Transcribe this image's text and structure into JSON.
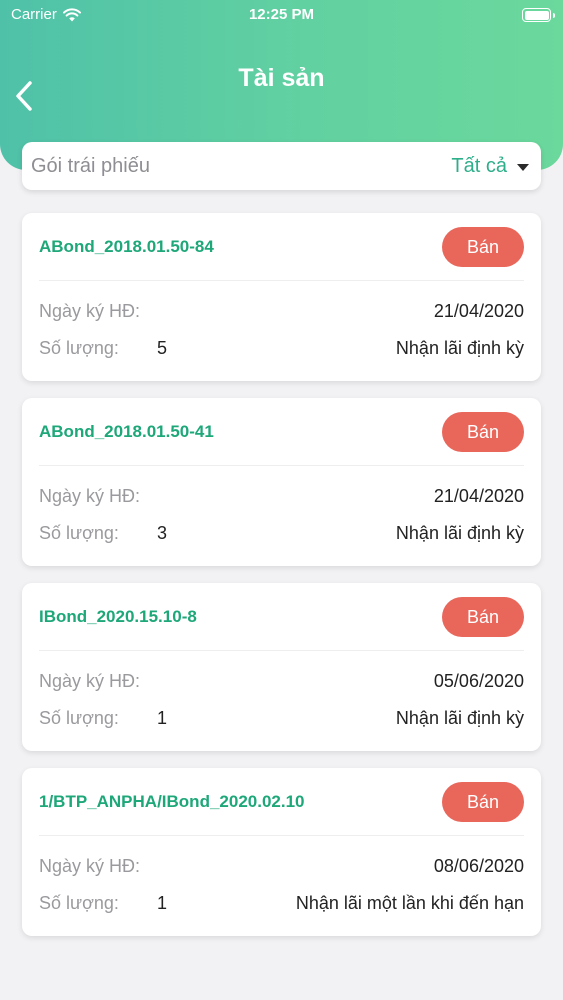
{
  "status_bar": {
    "carrier": "Carrier",
    "time": "12:25 PM"
  },
  "header": {
    "title": "Tài sản",
    "back_icon": "chevron-left-icon"
  },
  "filter": {
    "label": "Gói trái phiếu",
    "value": "Tất cả"
  },
  "labels": {
    "contract_date": "Ngày ký HĐ:",
    "quantity": "Số lượng:",
    "sell": "Bán"
  },
  "assets": [
    {
      "name": "ABond_2018.01.50-84",
      "date": "21/04/2020",
      "quantity": "5",
      "interest": "Nhận lãi định kỳ"
    },
    {
      "name": "ABond_2018.01.50-41",
      "date": "21/04/2020",
      "quantity": "3",
      "interest": "Nhận lãi định kỳ"
    },
    {
      "name": "IBond_2020.15.10-8",
      "date": "05/06/2020",
      "quantity": "1",
      "interest": "Nhận lãi định kỳ"
    },
    {
      "name": "1/BTP_ANPHA/IBond_2020.02.10",
      "date": "08/06/2020",
      "quantity": "1",
      "interest": "Nhận lãi một lần khi đến hạn"
    }
  ],
  "colors": {
    "accent": "#1ea779",
    "sell_button": "#e8665a",
    "header_start": "#4fc1a8",
    "header_end": "#6bd89c"
  }
}
